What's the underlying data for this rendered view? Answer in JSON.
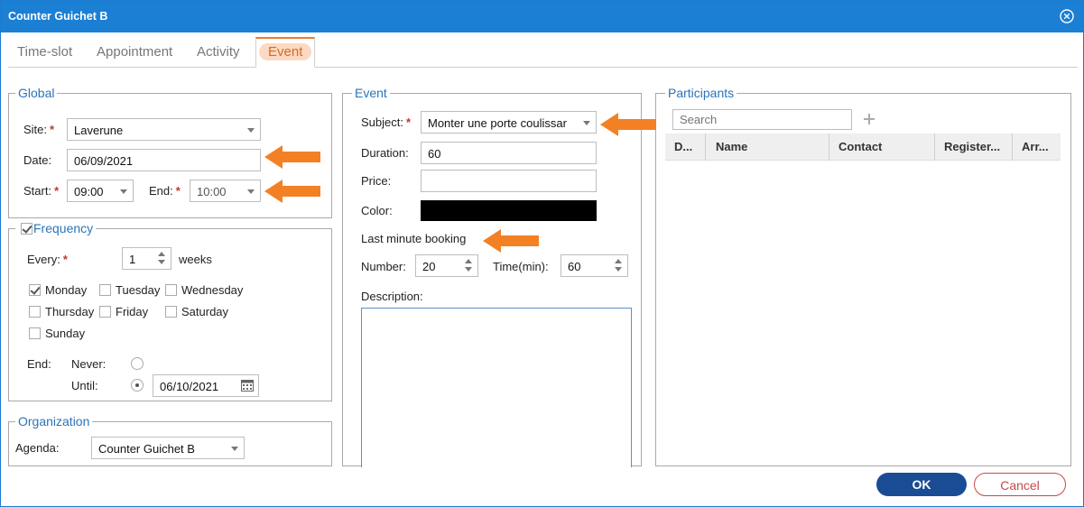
{
  "window": {
    "title": "Counter Guichet B"
  },
  "tabs": [
    {
      "label": "Time-slot"
    },
    {
      "label": "Appointment"
    },
    {
      "label": "Activity"
    },
    {
      "label": "Event",
      "active": true
    }
  ],
  "global": {
    "legend": "Global",
    "site_label": "Site:",
    "site_value": "Laverune",
    "date_label": "Date:",
    "date_value": "06/09/2021",
    "start_label": "Start:",
    "start_value": "09:00",
    "end_label": "End:",
    "end_value": "10:00"
  },
  "frequency": {
    "legend": "Frequency",
    "enabled": true,
    "every_label": "Every:",
    "every_value": "1",
    "every_unit": "weeks",
    "days": [
      {
        "label": "Monday",
        "checked": true
      },
      {
        "label": "Tuesday",
        "checked": false
      },
      {
        "label": "Wednesday",
        "checked": false
      },
      {
        "label": "Thursday",
        "checked": false
      },
      {
        "label": "Friday",
        "checked": false
      },
      {
        "label": "Saturday",
        "checked": false
      },
      {
        "label": "Sunday",
        "checked": false
      }
    ],
    "end_label": "End:",
    "never_label": "Never:",
    "until_label": "Until:",
    "until_value": "06/10/2021",
    "end_mode": "until"
  },
  "organization": {
    "legend": "Organization",
    "agenda_label": "Agenda:",
    "agenda_value": "Counter Guichet B"
  },
  "event": {
    "legend": "Event",
    "subject_label": "Subject:",
    "subject_value": "Monter une porte coulissar",
    "duration_label": "Duration:",
    "duration_value": "60",
    "price_label": "Price:",
    "price_value": "",
    "color_label": "Color:",
    "color_value": "#000000",
    "last_minute_label": "Last minute booking",
    "number_label": "Number:",
    "number_value": "20",
    "time_label": "Time(min):",
    "time_value": "60",
    "description_label": "Description:",
    "description_value": ""
  },
  "participants": {
    "legend": "Participants",
    "search_placeholder": "Search",
    "add_icon": "plus-icon",
    "columns": [
      "D...",
      "Name",
      "Contact",
      "Register...",
      "Arr..."
    ],
    "rows": []
  },
  "footer": {
    "ok_label": "OK",
    "cancel_label": "Cancel"
  },
  "colors": {
    "titlebar": "#1b7fd4",
    "accent": "#f07a2c",
    "legend": "#2a74b9",
    "ok": "#1a4b95",
    "cancel": "#c64a4a"
  },
  "annotations": {
    "arrow_color": "#f48024",
    "arrow_icon": "left-arrow-icon"
  }
}
